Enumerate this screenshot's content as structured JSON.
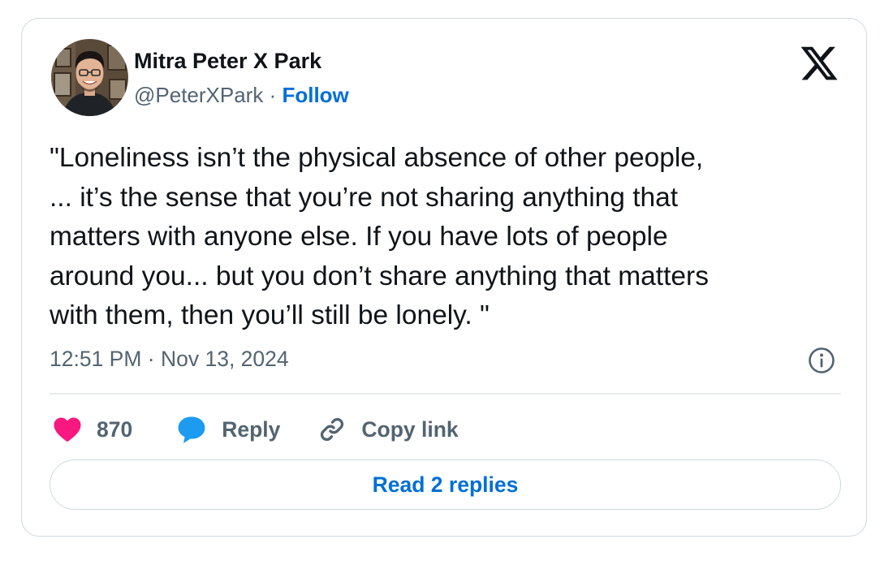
{
  "author": {
    "name": "Mitra Peter X Park",
    "handle": "@PeterXPark",
    "separator": " · ",
    "follow_label": "Follow"
  },
  "tweet": {
    "text": "\"Loneliness isn’t the physical absence of other people,\n... it’s the sense that you’re not sharing anything that\nmatters with anyone else.  If you have lots of people\naround you... but you don’t share anything that  matters\nwith them, then you’ll still be lonely. \"",
    "timestamp": "12:51 PM · Nov 13, 2024"
  },
  "actions": {
    "like_count": "870",
    "reply_label": "Reply",
    "copy_link_label": "Copy link"
  },
  "read_replies_label": "Read 2 replies",
  "icons": {
    "brand_logo": "x-logo-icon",
    "like": "heart-icon",
    "reply": "speech-bubble-icon",
    "copy": "link-icon",
    "info": "info-icon"
  },
  "colors": {
    "text_primary": "#0f1419",
    "text_secondary": "#536471",
    "link_blue": "#006fd6",
    "heart_pink": "#f91880",
    "reply_blue": "#1d9bf0",
    "border": "#cfd9de"
  }
}
